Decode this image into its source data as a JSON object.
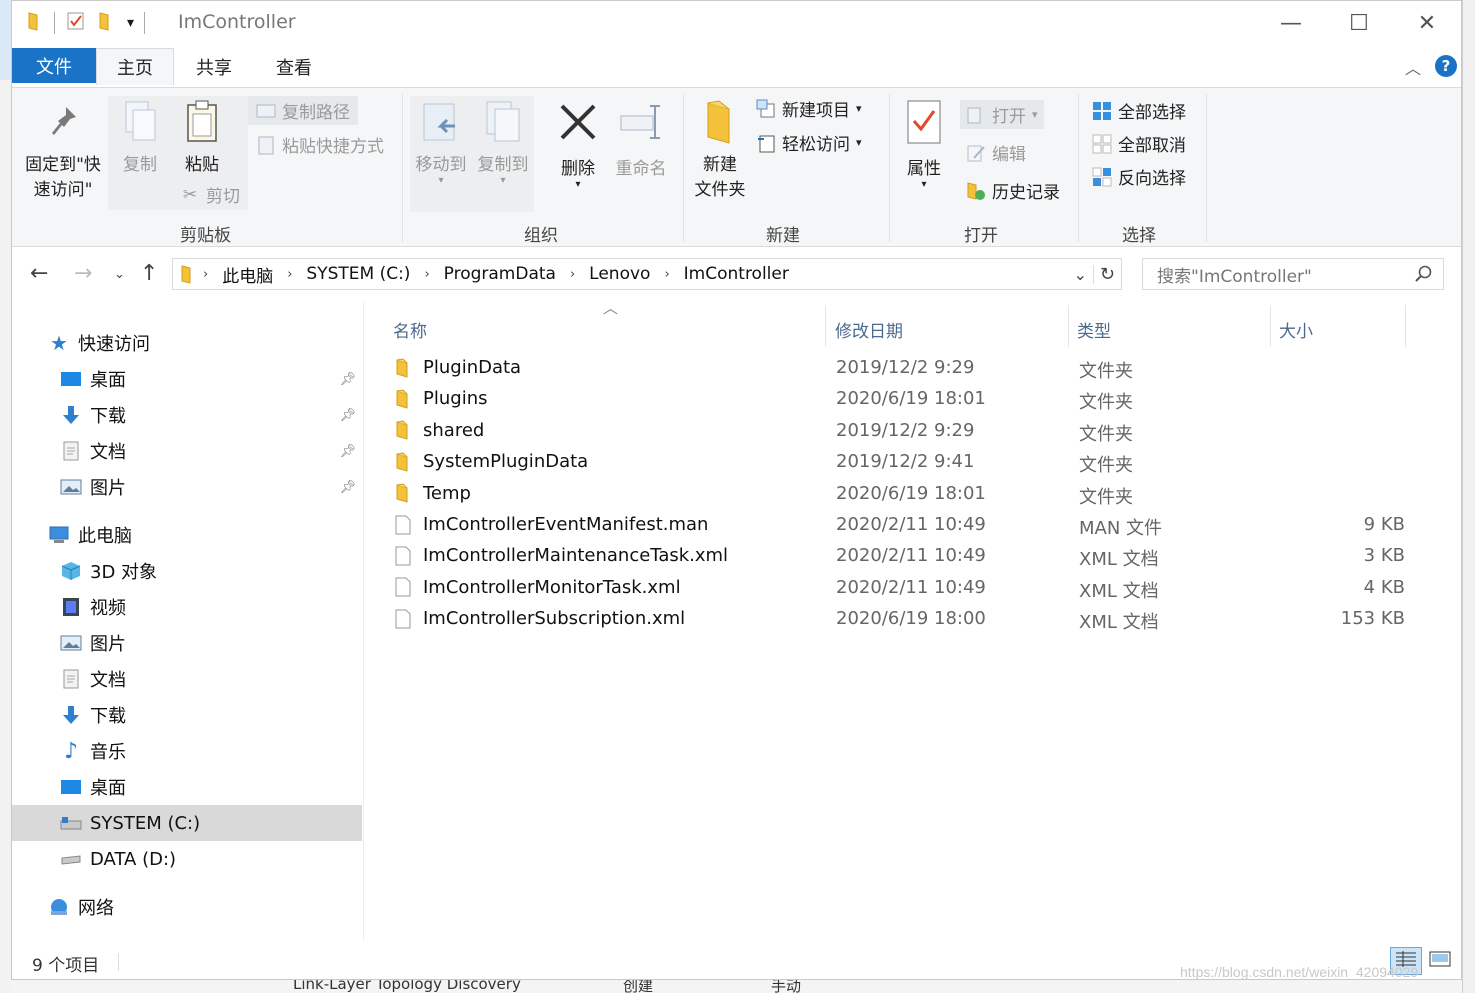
{
  "window": {
    "title": "ImController",
    "controls": {
      "minimize": "—",
      "maximize": "☐",
      "close": "✕"
    }
  },
  "ribbon_tabs": {
    "file": "文件",
    "home": "主页",
    "share": "共享",
    "view": "查看",
    "help": "?"
  },
  "ribbon": {
    "clipboard": {
      "pin_label_1": "固定到\"快",
      "pin_label_2": "速访问\"",
      "copy": "复制",
      "paste": "粘贴",
      "copy_path": "复制路径",
      "paste_shortcut": "粘贴快捷方式",
      "cut": "剪切",
      "group": "剪贴板"
    },
    "organize": {
      "move_to": "移动到",
      "copy_to": "复制到",
      "delete": "删除",
      "rename": "重命名",
      "group": "组织"
    },
    "new": {
      "new_folder_1": "新建",
      "new_folder_2": "文件夹",
      "new_item": "新建项目",
      "easy_access": "轻松访问",
      "group": "新建"
    },
    "open": {
      "properties": "属性",
      "open": "打开",
      "edit": "编辑",
      "history": "历史记录",
      "group": "打开"
    },
    "select": {
      "select_all": "全部选择",
      "select_none": "全部取消",
      "invert": "反向选择",
      "group": "选择"
    }
  },
  "address": {
    "crumbs": [
      "此电脑",
      "SYSTEM (C:)",
      "ProgramData",
      "Lenovo",
      "ImController"
    ],
    "search_placeholder": "搜索\"ImController\""
  },
  "sidebar": {
    "quick_access": "快速访问",
    "quick_items": [
      "桌面",
      "下载",
      "文档",
      "图片"
    ],
    "this_pc": "此电脑",
    "pc_items": [
      "3D 对象",
      "视频",
      "图片",
      "文档",
      "下载",
      "音乐",
      "桌面",
      "SYSTEM (C:)",
      "DATA (D:)"
    ],
    "network": "网络"
  },
  "columns": {
    "name": "名称",
    "modified": "修改日期",
    "type": "类型",
    "size": "大小"
  },
  "files": [
    {
      "name": "PluginData",
      "modified": "2019/12/2 9:29",
      "type": "文件夹",
      "size": "",
      "kind": "folder"
    },
    {
      "name": "Plugins",
      "modified": "2020/6/19 18:01",
      "type": "文件夹",
      "size": "",
      "kind": "folder"
    },
    {
      "name": "shared",
      "modified": "2019/12/2 9:29",
      "type": "文件夹",
      "size": "",
      "kind": "folder"
    },
    {
      "name": "SystemPluginData",
      "modified": "2019/12/2 9:41",
      "type": "文件夹",
      "size": "",
      "kind": "folder"
    },
    {
      "name": "Temp",
      "modified": "2020/6/19 18:01",
      "type": "文件夹",
      "size": "",
      "kind": "folder"
    },
    {
      "name": "ImControllerEventManifest.man",
      "modified": "2020/2/11 10:49",
      "type": "MAN 文件",
      "size": "9 KB",
      "kind": "file"
    },
    {
      "name": "ImControllerMaintenanceTask.xml",
      "modified": "2020/2/11 10:49",
      "type": "XML 文档",
      "size": "3 KB",
      "kind": "file"
    },
    {
      "name": "ImControllerMonitorTask.xml",
      "modified": "2020/2/11 10:49",
      "type": "XML 文档",
      "size": "4 KB",
      "kind": "file"
    },
    {
      "name": "ImControllerSubscription.xml",
      "modified": "2020/6/19 18:00",
      "type": "XML 文档",
      "size": "153 KB",
      "kind": "file"
    }
  ],
  "status": {
    "count": "9 个项目"
  },
  "background": {
    "bottom_text_1": "Link-Layer Topology Discovery",
    "bottom_text_2": "创建",
    "bottom_text_3": "手动",
    "watermark": "https://blog.csdn.net/weixin_42094029"
  },
  "colors": {
    "accent": "#1a73c6",
    "folder": "#f3c13a",
    "header_text": "#4d6a90"
  }
}
